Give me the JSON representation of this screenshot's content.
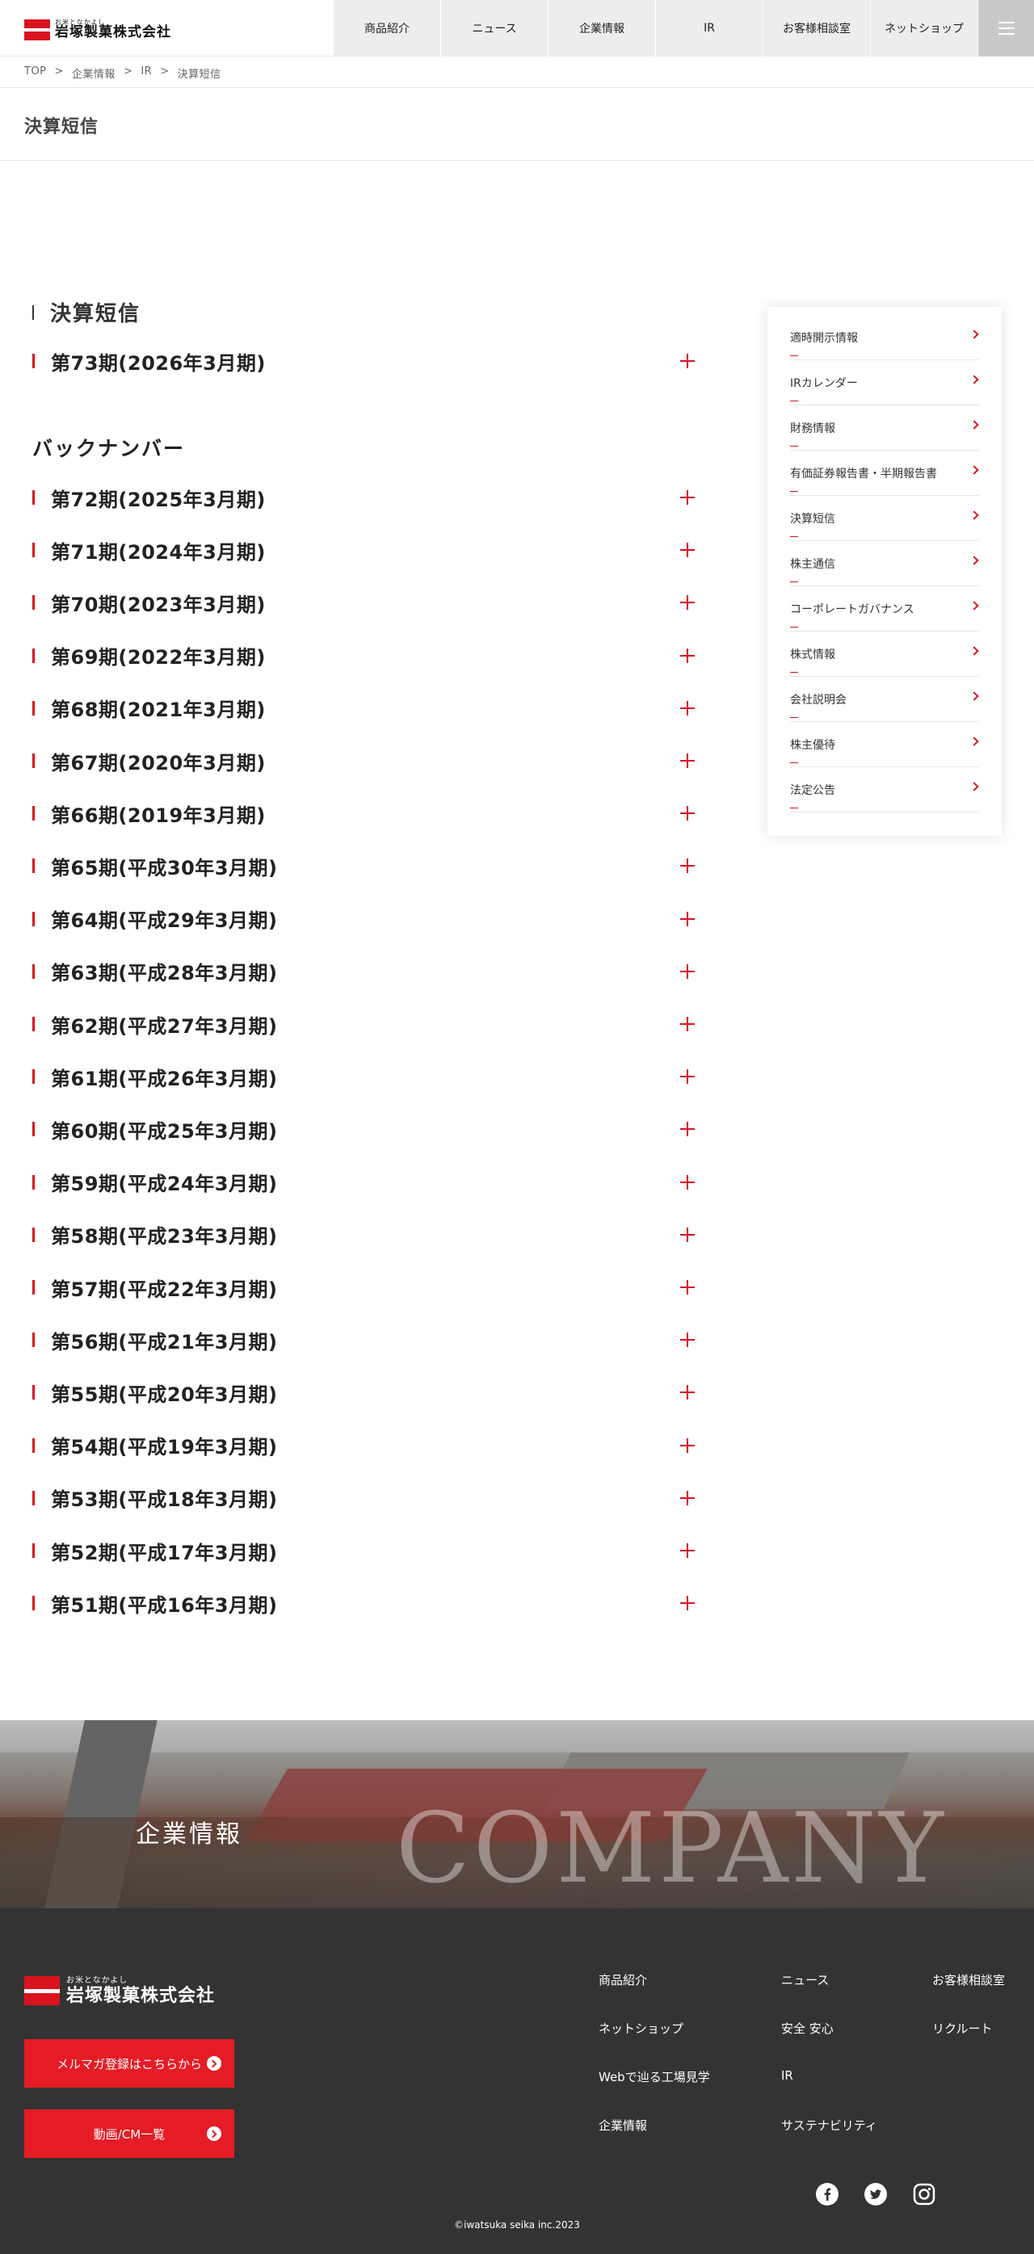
{
  "header": {
    "logo_ruby": "お米となかよし",
    "logo_name": "岩塚製菓株式会社",
    "nav": [
      "商品紹介",
      "ニュース",
      "企業情報",
      "IR",
      "お客様相談室",
      "ネットショップ"
    ]
  },
  "breadcrumb": [
    "TOP",
    "企業情報",
    "IR",
    "決算短信"
  ],
  "page_title": "決算短信",
  "main": {
    "section_heading": "決算短信",
    "current": "第73期(2026年3月期)",
    "backnumber_heading": "バックナンバー",
    "backnumbers": [
      "第72期(2025年3月期)",
      "第71期(2024年3月期)",
      "第70期(2023年3月期)",
      "第69期(2022年3月期)",
      "第68期(2021年3月期)",
      "第67期(2020年3月期)",
      "第66期(2019年3月期)",
      "第65期(平成30年3月期)",
      "第64期(平成29年3月期)",
      "第63期(平成28年3月期)",
      "第62期(平成27年3月期)",
      "第61期(平成26年3月期)",
      "第60期(平成25年3月期)",
      "第59期(平成24年3月期)",
      "第58期(平成23年3月期)",
      "第57期(平成22年3月期)",
      "第56期(平成21年3月期)",
      "第55期(平成20年3月期)",
      "第54期(平成19年3月期)",
      "第53期(平成18年3月期)",
      "第52期(平成17年3月期)",
      "第51期(平成16年3月期)"
    ]
  },
  "sidenav": [
    "適時開示情報",
    "IRカレンダー",
    "財務情報",
    "有価証券報告書・半期報告書",
    "決算短信",
    "株主通信",
    "コーポレートガバナンス",
    "株式情報",
    "会社説明会",
    "株主優待",
    "法定公告"
  ],
  "banner": {
    "title": "企業情報",
    "watermark": "COMPANY"
  },
  "footer": {
    "logo_ruby": "お米となかよし",
    "logo_name": "岩塚製菓株式会社",
    "buttons": [
      "メルマガ登録はこちらから",
      "動画/CM一覧"
    ],
    "links": {
      "col1": [
        "商品紹介",
        "ネットショップ",
        "Webで辿る工場見学",
        "企業情報"
      ],
      "col2": [
        "ニュース",
        "安全 安心",
        "IR",
        "サステナビリティ"
      ],
      "col3": [
        "お客様相談室",
        "リクルート"
      ]
    },
    "social": [
      "facebook-icon",
      "twitter-icon",
      "instagram-icon"
    ],
    "copyright": "©iwatsuka seika inc.2023"
  },
  "colors": {
    "accent": "#d9131f",
    "footer_bg": "#333333",
    "nav_bg": "#ededed"
  }
}
